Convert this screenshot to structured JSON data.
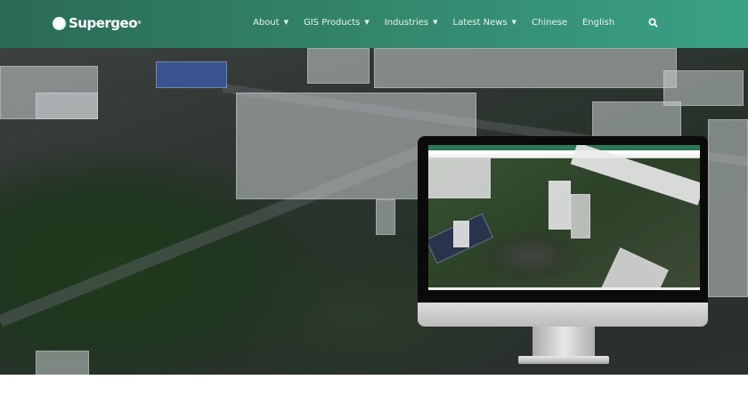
{
  "brand": {
    "name": "Supergeo",
    "mark": "®"
  },
  "nav": {
    "items": [
      {
        "label": "About",
        "has_dropdown": true
      },
      {
        "label": "GIS Products",
        "has_dropdown": true
      },
      {
        "label": "Industries",
        "has_dropdown": true
      },
      {
        "label": "Latest News",
        "has_dropdown": true
      },
      {
        "label": "Chinese",
        "has_dropdown": false
      },
      {
        "label": "English",
        "has_dropdown": false
      }
    ],
    "chevron": "⌄",
    "search_icon": "search-icon"
  },
  "colors": {
    "header_start": "#2a6a56",
    "header_end": "#3aa185"
  }
}
